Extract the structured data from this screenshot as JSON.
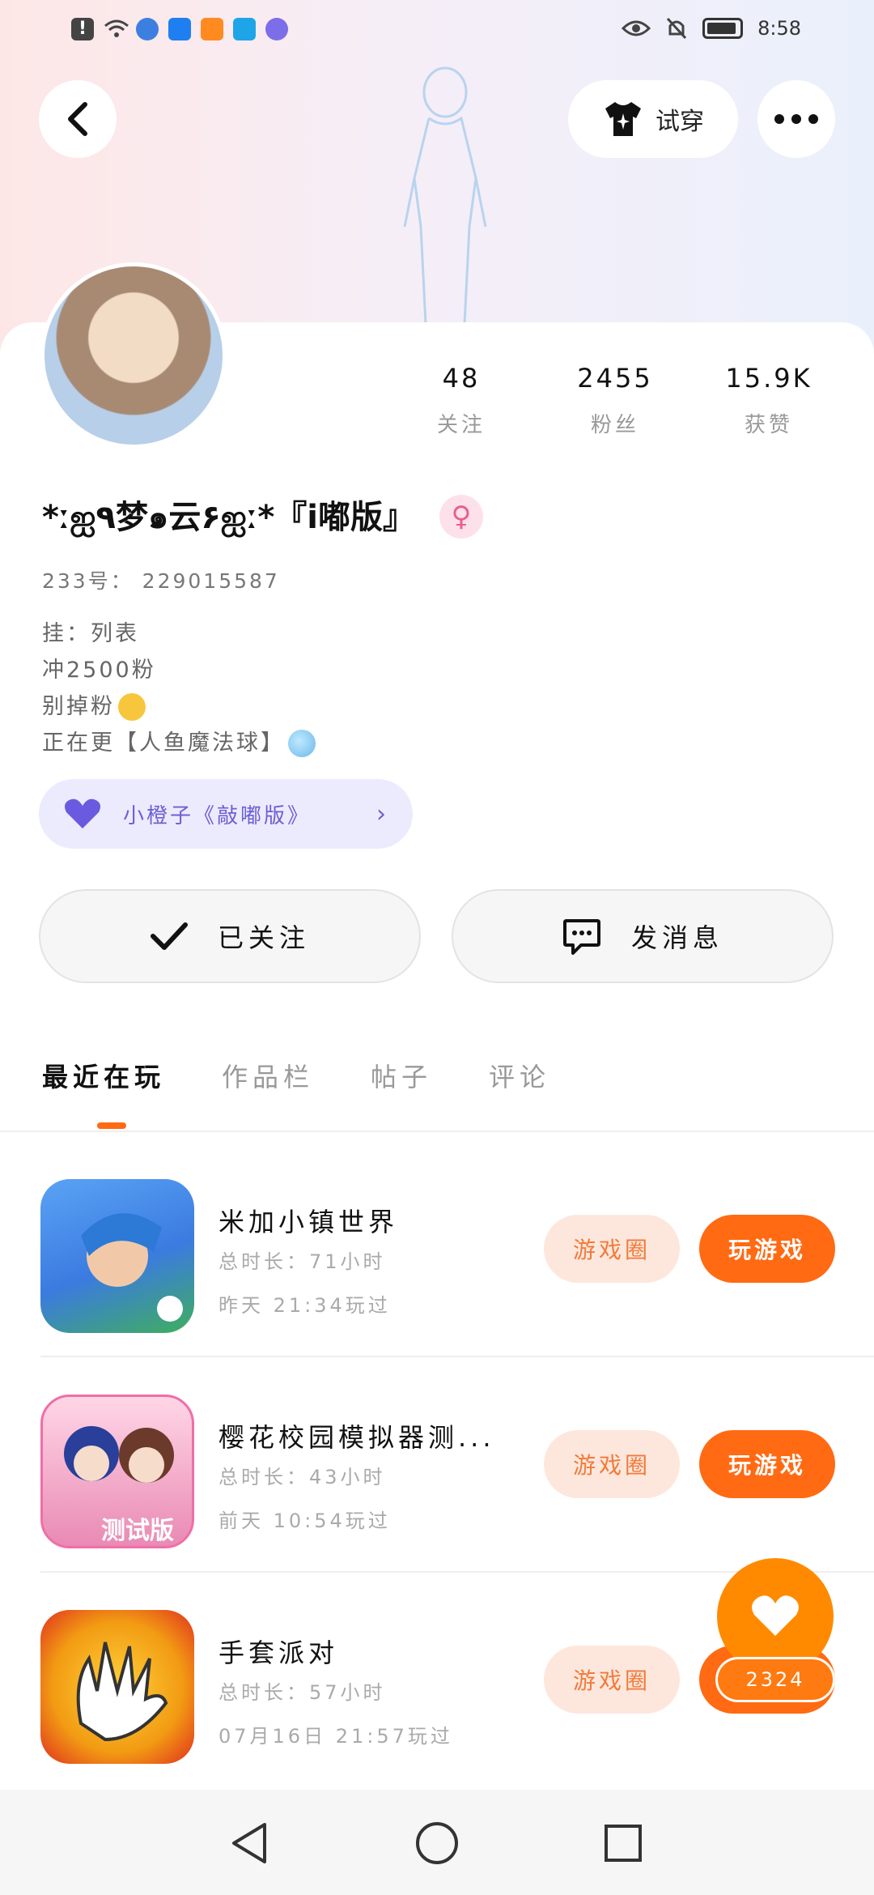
{
  "status_bar": {
    "time": "8:58",
    "left_icons": [
      "alert-icon",
      "wifi-icon",
      "app-icon",
      "bulb-app-icon",
      "video-app-icon",
      "search-app-icon",
      "music-app-icon"
    ],
    "right_icons": [
      "eye-icon",
      "mute-icon",
      "battery-icon"
    ]
  },
  "header": {
    "try_on_label": "试穿"
  },
  "profile": {
    "name": "*ːஐ٩梦๑云۶ஐː*『i嘟版』",
    "uid": "233号： 229015587",
    "stats": [
      {
        "value": "48",
        "label": "关注"
      },
      {
        "value": "2455",
        "label": "粉丝"
      },
      {
        "value": "15.9K",
        "label": "获赞"
      }
    ],
    "bio": [
      "挂：列表",
      "冲2500粉",
      "别掉粉",
      "正在更【人鱼魔法球】"
    ],
    "fan_badge": "小橙子《敲嘟版》",
    "follow_label": "已关注",
    "message_label": "发消息"
  },
  "tabs": [
    "最近在玩",
    "作品栏",
    "帖子",
    "评论"
  ],
  "games": [
    {
      "title": "米加小镇世界",
      "duration": "总时长：71小时",
      "last_played": "昨天 21:34玩过"
    },
    {
      "title": "樱花校园模拟器测...",
      "duration": "总时长：43小时",
      "last_played": "前天 10:54玩过",
      "icon_label": "测试版"
    },
    {
      "title": "手套派对",
      "duration": "总时长：57小时",
      "last_played": "07月16日 21:57玩过"
    }
  ],
  "game_actions": {
    "circle_label": "游戏圈",
    "play_label": "玩游戏"
  },
  "like_count": "2324",
  "colors": {
    "accent": "#ff6a13",
    "circle_bg": "#fde7dc",
    "fan_badge_bg": "#ecebfd",
    "fan_badge_text": "#6b5fd6"
  }
}
